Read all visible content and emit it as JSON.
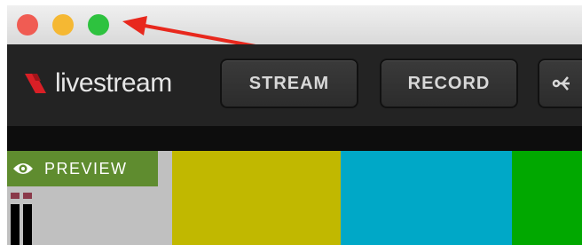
{
  "window": {
    "traffic_lights": {
      "close_color": "#f05c53",
      "minimize_color": "#f5b833",
      "maximize_color": "#2ec23f"
    },
    "annotation_arrow_color": "#e8281d"
  },
  "toolbar": {
    "logo_text": "livestream",
    "logo_color": "#d91f26",
    "stream_label": "STREAM",
    "record_label": "RECORD",
    "share_icon": "share-icon"
  },
  "preview": {
    "label": "PREVIEW",
    "label_bg": "#5f8c2f",
    "color_bars": [
      "#c0c0c0",
      "#c1b800",
      "#00a8c7",
      "#01a800"
    ]
  }
}
